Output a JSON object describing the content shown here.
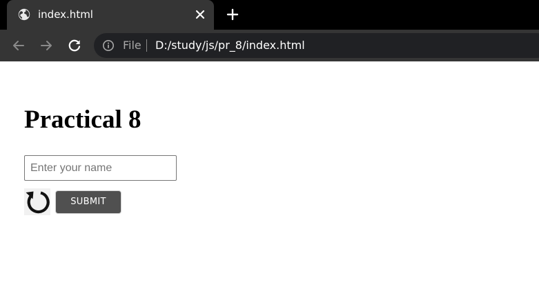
{
  "browser": {
    "tab": {
      "title": "index.html",
      "favicon_icon": "globe-icon",
      "close_icon": "close-icon"
    },
    "new_tab_icon": "plus-icon",
    "nav": {
      "back_icon": "arrow-left-icon",
      "forward_icon": "arrow-right-icon",
      "reload_icon": "reload-icon"
    },
    "omnibox": {
      "info_icon": "info-icon",
      "scheme_label": "File",
      "url": "D:/study/js/pr_8/index.html"
    },
    "colors": {
      "tabstrip": "#000000",
      "tab_active": "#353535",
      "omnibox": "#202124"
    }
  },
  "page": {
    "heading": "Practical 8",
    "name_input": {
      "placeholder": "Enter your name",
      "value": ""
    },
    "reset_button_icon": "reset-arrow-icon",
    "submit_button": {
      "label": "SUBMIT",
      "color": "#505050"
    }
  }
}
